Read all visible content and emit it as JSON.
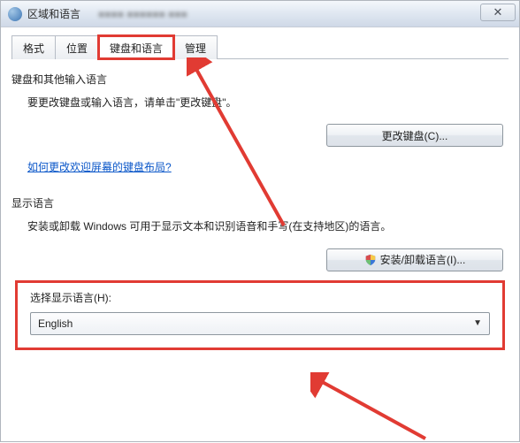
{
  "titlebar": {
    "title": "区域和语言"
  },
  "tabs": {
    "t0": "格式",
    "t1": "位置",
    "t2": "键盘和语言",
    "t3": "管理"
  },
  "keyboard_section": {
    "title": "键盘和其他输入语言",
    "desc": "要更改键盘或输入语言，请单击\"更改键盘\"。",
    "change_btn": "更改键盘(C)...",
    "link": "如何更改欢迎屏幕的键盘布局?"
  },
  "display_section": {
    "title": "显示语言",
    "desc": "安装或卸载 Windows 可用于显示文本和识别语音和手写(在支持地区)的语言。",
    "install_btn": "安装/卸载语言(I)...",
    "select_label": "选择显示语言(H):",
    "selected": "English"
  }
}
